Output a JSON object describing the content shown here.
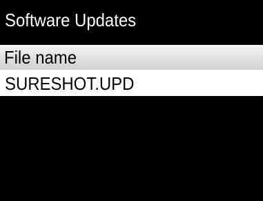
{
  "screen": {
    "title": "Software Updates"
  },
  "file_list": {
    "column_header": "File name",
    "items": [
      {
        "name": "SURESHOT.UPD",
        "selected": true
      }
    ]
  },
  "colors": {
    "background": "#000000",
    "title_text": "#ffffff",
    "header_background": "#e2e2e2",
    "selected_row_background": "#ffffff",
    "row_text": "#000000"
  }
}
